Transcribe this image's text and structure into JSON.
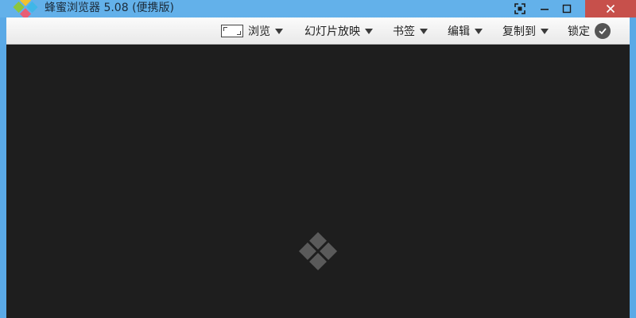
{
  "window": {
    "title": "蜂蜜浏览器 5.08 (便携版)"
  },
  "toolbar": {
    "browse_label": "浏览",
    "slideshow_label": "幻灯片放映",
    "bookmarks_label": "书签",
    "edit_label": "编辑",
    "copyto_label": "复制到",
    "lock_label": "锁定"
  },
  "icons": {
    "app_logo": "honeyview-diamond-logo-icon",
    "fullscreen": "fullscreen-icon",
    "minimize": "minimize-icon",
    "maximize": "maximize-icon",
    "close": "close-icon",
    "browse": "frame-icon",
    "lock": "check-circle-icon",
    "placeholder": "diamond-grid-icon"
  },
  "colors": {
    "titlebar": "#63b1ea",
    "close_button": "#c7504b",
    "viewer_background": "#1e1e1e",
    "placeholder_logo": "#5a5a5a"
  }
}
